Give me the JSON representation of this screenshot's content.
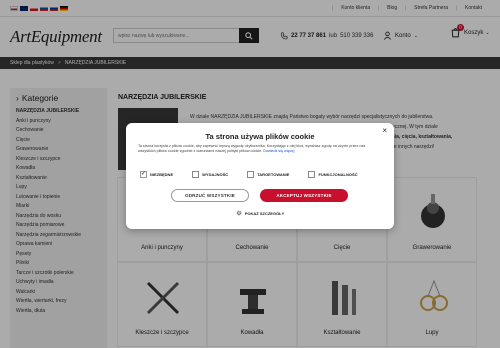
{
  "topbar": {
    "links": [
      "Konto klienta",
      "Blog",
      "Strefa Partnera",
      "Kontakt"
    ]
  },
  "header": {
    "logo": "ArtEquipment",
    "search_placeholder": "wpisz nazwę lub wyszukiwane...",
    "phone_main": "22 77 37 861",
    "phone_sep": "lub",
    "phone_alt": "510 339 336",
    "account_label": "Konto",
    "cart_label": "Koszyk",
    "cart_count": "0"
  },
  "breadcrumb": {
    "home": "Sklep dla plastyków",
    "sep": ">",
    "current": "NARZĘDZIA JUBILERSKIE"
  },
  "sidebar": {
    "title": "Kategorie",
    "items": [
      "NARZĘDZIA JUBILERSKIE",
      "Anki i punczyny",
      "Cechowanie",
      "Cięcie",
      "Grawerowanie",
      "Kleszcze i szczypce",
      "Kowadła",
      "Kształtowanie",
      "Lupy",
      "Lutowanie i topienie",
      "Miarki",
      "Narzędzia do wosku",
      "Narzędzia pomiarowe",
      "Narzędzia zegarmistrzowskie",
      "Oprawa kamieni",
      "Pęsety",
      "Pilniki",
      "Tarcze i szczotki polerskie",
      "Uchwyty i imadła",
      "Walcarki",
      "Wiertła, wiertarki, frezy",
      "Wiertła, dłuta"
    ]
  },
  "main": {
    "title": "NARZĘDZIA JUBILERSKIE",
    "desc_lines": [
      "W dziale NARZĘDZIA JUBILERSKIE znajdą Państwo bogaty wybór narzędzi specjalistycznych do jubilerstwa.",
      "artystycznej. W tym dziale",
      "rowania, cięcia, kształtowania,",
      "ele innych narzędzi!"
    ],
    "tiles": [
      "Anki i punczyny",
      "Cechowanie",
      "Cięcie",
      "Grawerowanie",
      "Kleszcze i szczypce",
      "Kowadła",
      "Kształtowanie",
      "Lupy"
    ]
  },
  "cookie": {
    "title": "Ta strona używa plików cookie",
    "text": "Ta strona korzysta z plików cookie, aby zapewnić lepszą wygodę użytkownika. Korzystając z niej ktoś, wyrażasz zgodę na użycie przez nas wszystkich plików cookie zgodnie z warunkami naszej polityki plików cookie.",
    "link": "Dowiedz się więcej",
    "checks": [
      {
        "label": "NIEZBĘDNE",
        "checked": true
      },
      {
        "label": "WYDAJNOŚĆ",
        "checked": false
      },
      {
        "label": "TARGETOWANIE",
        "checked": false
      },
      {
        "label": "FUNKCJONALNOŚĆ",
        "checked": false
      }
    ],
    "reject": "ODRZUĆ WSZYSTKIE",
    "accept": "AKCEPTUJ WSZYSTKIE",
    "details": "POKAŻ SZCZEGÓŁY",
    "close": "×"
  },
  "colors": {
    "accent": "#c8102e",
    "dark": "#3a3a3a",
    "link": "#1a4fd8"
  }
}
